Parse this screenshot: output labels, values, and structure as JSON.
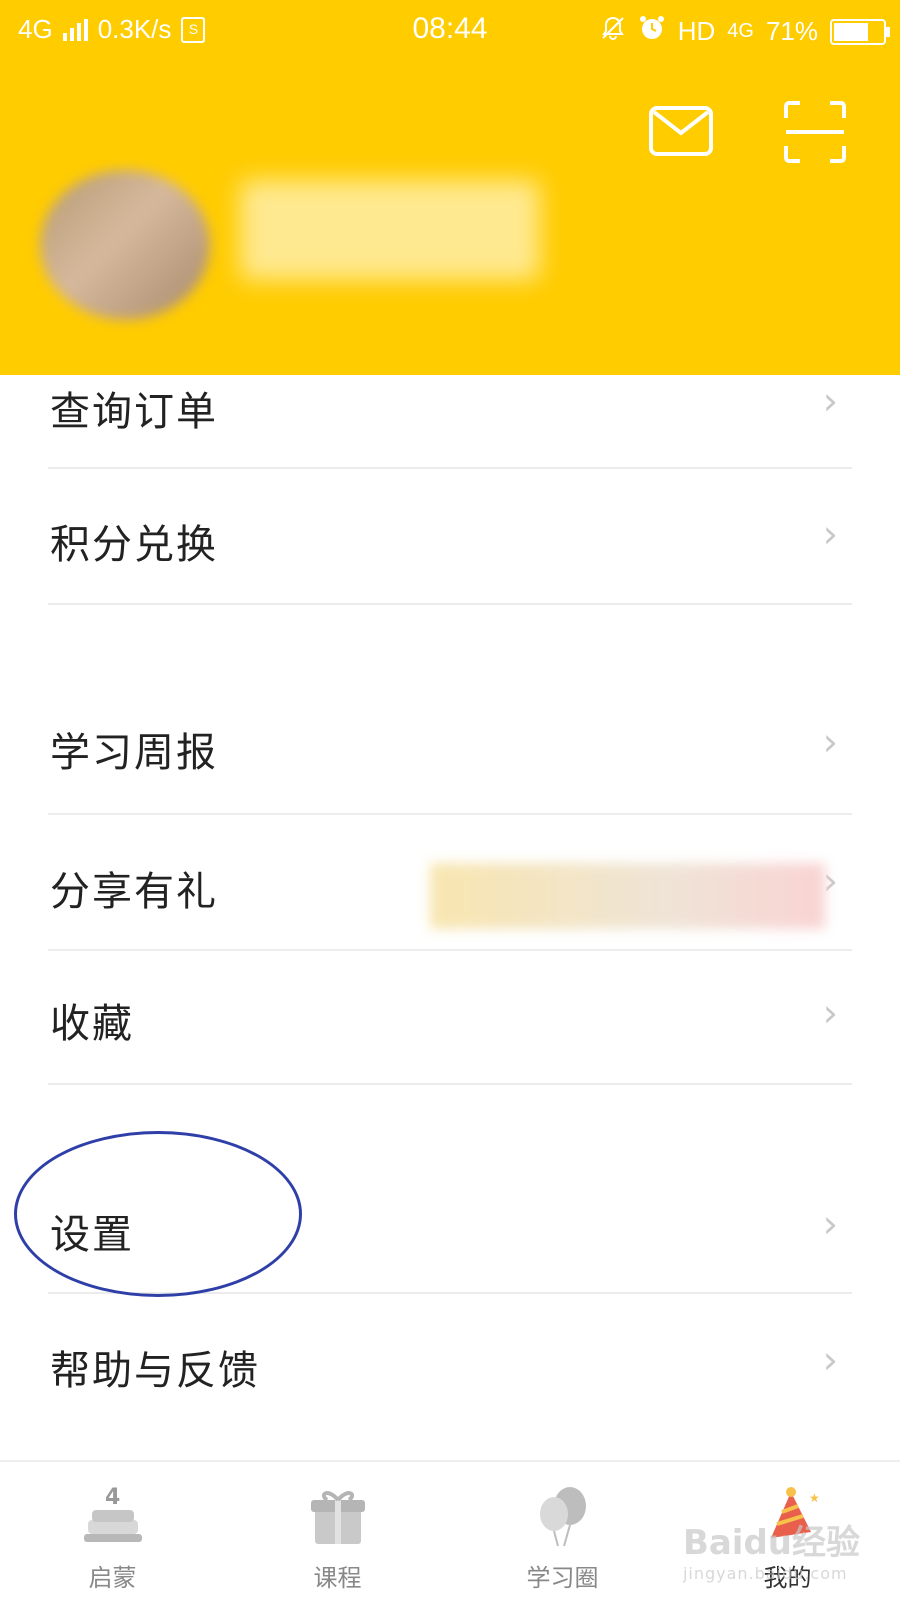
{
  "status_bar": {
    "network": "4G",
    "speed": "0.3K/s",
    "s_badge": "S",
    "time": "08:44",
    "hd": "HD",
    "network_right": "4G",
    "battery": "71%"
  },
  "header": {
    "mail_icon": "mail-icon",
    "scan_icon": "scan-icon",
    "accent_color": "#FFCC00"
  },
  "menu": {
    "items": [
      {
        "label": "查询订单"
      },
      {
        "label": "积分兑换"
      },
      {
        "label": "学习周报"
      },
      {
        "label": "分享有礼"
      },
      {
        "label": "收藏"
      },
      {
        "label": "设置"
      },
      {
        "label": "帮助与反馈"
      }
    ],
    "chevron": "›"
  },
  "tabbar": {
    "tabs": [
      {
        "label": "启蒙",
        "icon": "cake-icon"
      },
      {
        "label": "课程",
        "icon": "gift-icon"
      },
      {
        "label": "学习圈",
        "icon": "balloons-icon"
      },
      {
        "label": "我的",
        "icon": "party-hat-icon"
      }
    ],
    "active_index": 3
  },
  "watermark": {
    "brand": "Baidu经验",
    "url": "jingyan.baidu.com"
  }
}
